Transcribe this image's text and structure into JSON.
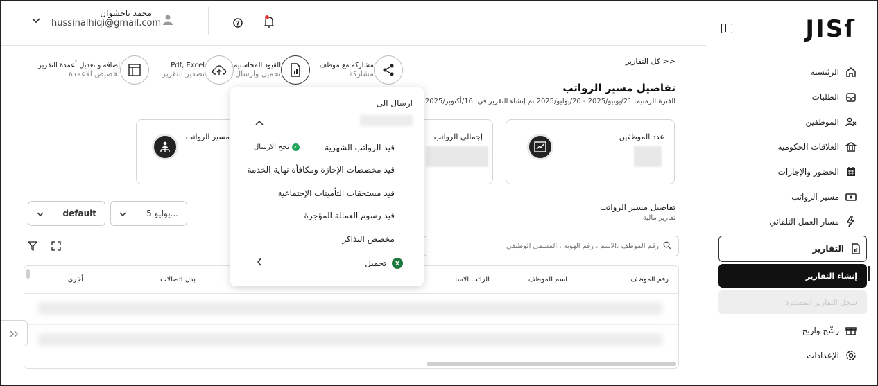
{
  "app": {
    "logo": "JISſ"
  },
  "sidebar": {
    "items": [
      {
        "label": "الرئيسية",
        "icon": "home-icon"
      },
      {
        "label": "الطلبات",
        "icon": "inbox-icon"
      },
      {
        "label": "الموظفين",
        "icon": "users-icon"
      },
      {
        "label": "العلاقات الحكومية",
        "icon": "government-icon"
      },
      {
        "label": "الحضور والإجازات",
        "icon": "calendar-icon"
      },
      {
        "label": "مسير الرواتب",
        "icon": "money-icon"
      },
      {
        "label": "مسار العمل التلقائي",
        "icon": "automation-icon"
      },
      {
        "label": "التقارير",
        "icon": "report-icon"
      }
    ],
    "sub_items": [
      {
        "label": "إنشاء التقارير"
      },
      {
        "label": "سجل التقارير المصدرة"
      }
    ],
    "bottom_items": [
      {
        "label": "رشّح واربح",
        "icon": "gift-icon"
      },
      {
        "label": "الإعدادات",
        "icon": "settings-icon"
      }
    ]
  },
  "header": {
    "user_name": "محمد باحشوان",
    "user_email": "hussinalhiqi@gmail.com"
  },
  "toolbar": {
    "share": {
      "line1": "مشاركة مع موظف",
      "line2": "مشاركة"
    },
    "accounting": {
      "line1": "القيود المحاسبية",
      "line2": "تحميل وارسال"
    },
    "export": {
      "line1": "Pdf, Excel",
      "line2": "تصدير التقرير"
    },
    "columns": {
      "line1": "إضافة و تعديل أعمدة التقرير",
      "line2": "تخصيص الاعمدة"
    }
  },
  "page": {
    "breadcrumb": "<< كل التقارير",
    "title": "تفاصيل مسير الرواتب",
    "period": "الفترة الزمنية: 21/يونيو/2025 - 20/يوليو/2025 تم إنشاء التقرير في: 16/أكتوبر/2025"
  },
  "cards": {
    "employees": "عدد الموظفين",
    "total_salaries": "إجمالي الرواتب",
    "payroll": "مسير الرواتب"
  },
  "section": {
    "title": "تفاصيل مسير الرواتب",
    "subtitle": "تقارير مالية"
  },
  "filters": {
    "month": "يوليو 5...",
    "view": "default"
  },
  "search": {
    "placeholder": "رقم الموظف ،الاسم ، رقم الهوية ، المسمى الوظيفي"
  },
  "table": {
    "headers": [
      "رقم الموظف",
      "اسم الموظف",
      "الراتب الاسا",
      "بدل اتصالات",
      "أخرى"
    ]
  },
  "popup": {
    "title": "ارسال الى",
    "items": [
      "قيد الرواتب الشهرية",
      "قيد مخصصات الإجازة ومكافأة نهاية الخدمة",
      "قيد مستحقات التأمينات الإجتماعية",
      "قيد رسوم العمالة المؤجرة",
      "مخصص التذاكر"
    ],
    "success_label": "نجح الارسال",
    "download_label": "تحميل"
  }
}
